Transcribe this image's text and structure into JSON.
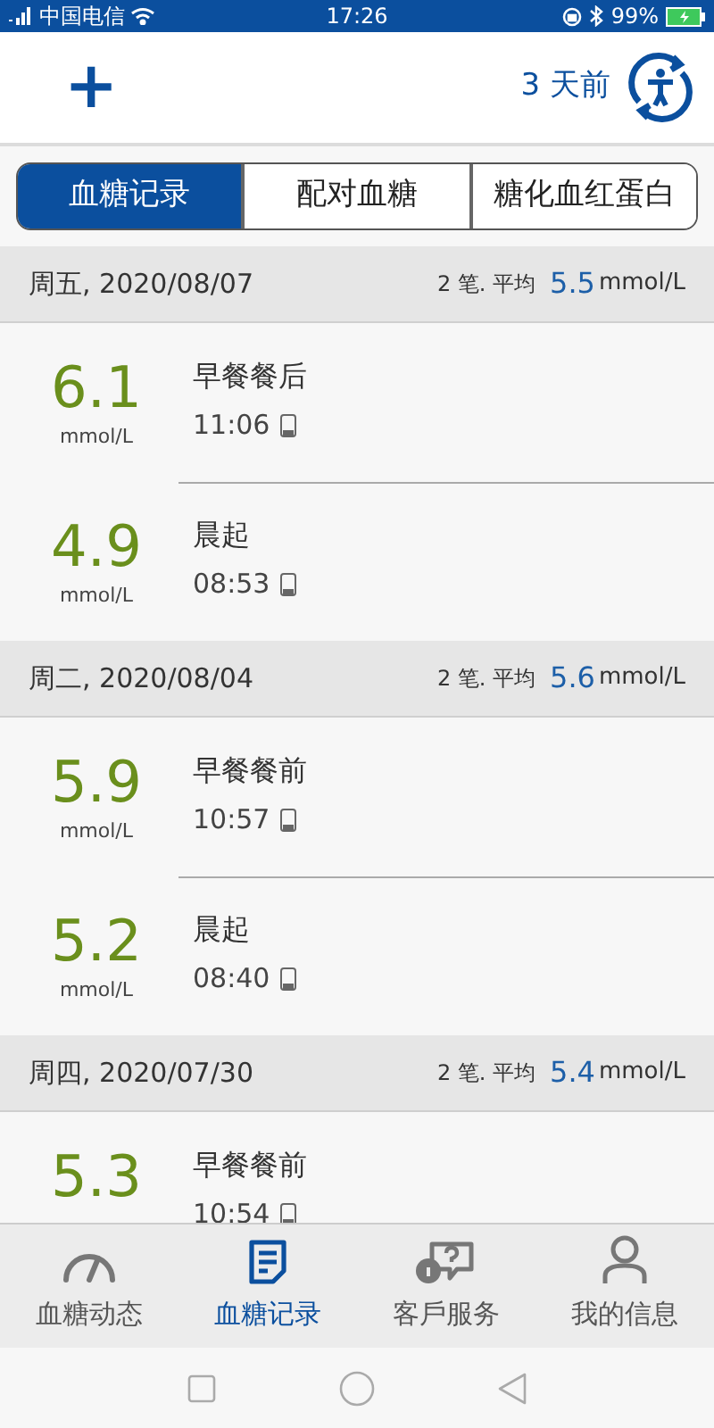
{
  "status_bar": {
    "carrier": "中国电信",
    "time": "17:26",
    "battery": "99%"
  },
  "header": {
    "add": "+",
    "last_sync": "3 天前"
  },
  "tabs": [
    {
      "label": "血糖记录",
      "selected": true
    },
    {
      "label": "配对血糖",
      "selected": false
    },
    {
      "label": "糖化血红蛋白",
      "selected": false
    }
  ],
  "days": [
    {
      "date": "周五, 2020/08/07",
      "count": "2 笔. 平均",
      "average": "5.5",
      "average_unit": "mmol/L",
      "records": [
        {
          "value": "6.1",
          "unit": "mmol/L",
          "meal": "早餐餐后",
          "time": "11:06"
        },
        {
          "value": "4.9",
          "unit": "mmol/L",
          "meal": "晨起",
          "time": "08:53"
        }
      ]
    },
    {
      "date": "周二, 2020/08/04",
      "count": "2 笔. 平均",
      "average": "5.6",
      "average_unit": "mmol/L",
      "records": [
        {
          "value": "5.9",
          "unit": "mmol/L",
          "meal": "早餐餐前",
          "time": "10:57"
        },
        {
          "value": "5.2",
          "unit": "mmol/L",
          "meal": "晨起",
          "time": "08:40"
        }
      ]
    },
    {
      "date": "周四, 2020/07/30",
      "count": "2 笔. 平均",
      "average": "5.4",
      "average_unit": "mmol/L",
      "records": [
        {
          "value": "5.3",
          "meal": "早餐餐前",
          "time": "10:54"
        }
      ]
    }
  ],
  "bottom_nav": [
    {
      "kind": "gauge",
      "label": "血糖动态",
      "selected": false
    },
    {
      "kind": "record",
      "label": "血糖记录",
      "selected": true
    },
    {
      "kind": "service",
      "label": "客戶服务",
      "selected": false
    },
    {
      "kind": "person",
      "label": "我的信息",
      "selected": false
    }
  ]
}
